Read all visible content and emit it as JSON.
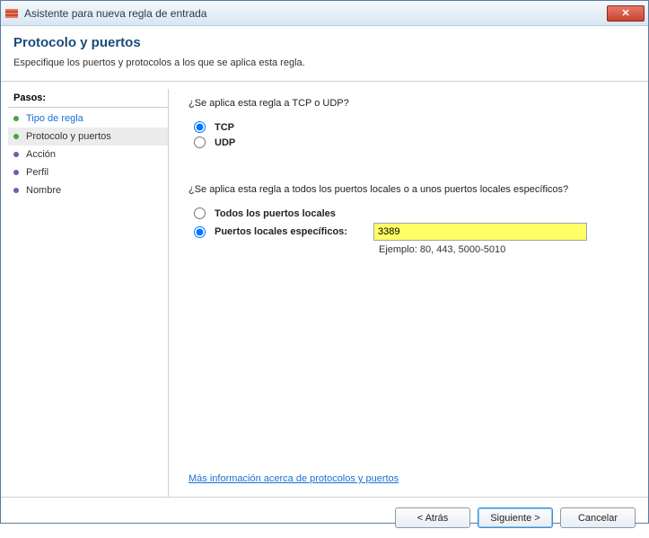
{
  "window": {
    "title": "Asistente para nueva regla de entrada",
    "close_glyph": "✕"
  },
  "header": {
    "title": "Protocolo y puertos",
    "subtitle": "Especifique los puertos y protocolos a los que se aplica esta regla."
  },
  "sidebar": {
    "title": "Pasos:",
    "steps": [
      {
        "label": "Tipo de regla"
      },
      {
        "label": "Protocolo y puertos"
      },
      {
        "label": "Acción"
      },
      {
        "label": "Perfil"
      },
      {
        "label": "Nombre"
      }
    ]
  },
  "content": {
    "q_proto": "¿Se aplica esta regla a TCP o UDP?",
    "tcp_label": "TCP",
    "udp_label": "UDP",
    "q_ports": "¿Se aplica esta regla a todos los puertos locales o a unos puertos locales específicos?",
    "all_ports_label": "Todos los puertos locales",
    "specific_ports_label": "Puertos locales específicos:",
    "port_value": "3389",
    "example": "Ejemplo: 80, 443, 5000-5010",
    "more_link": "Más información acerca de protocolos y puertos"
  },
  "footer": {
    "back": "< Atrás",
    "next": "Siguiente >",
    "cancel": "Cancelar"
  }
}
